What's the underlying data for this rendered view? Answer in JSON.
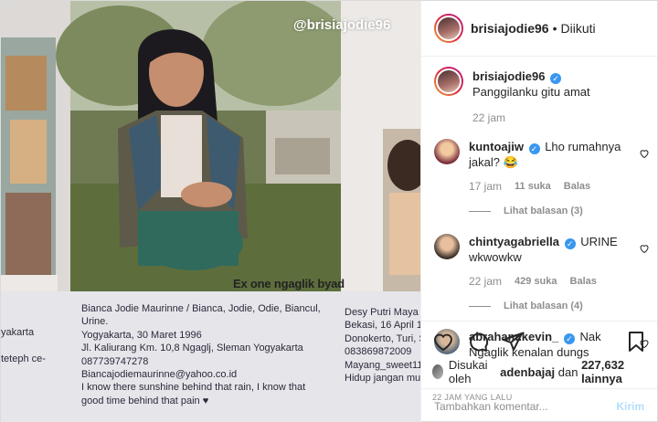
{
  "photo": {
    "watermark": "@brisiajodie96",
    "overlay_caption": "Ex one ngaglik byad",
    "bio_lines": [
      "Bianca Jodie Maurinne / Bianca, Jodie, Odie, Biancul,",
      "Urine.",
      "Yogyakarta, 30 Maret 1996",
      "Jl. Kaliurang Km. 10,8 Ngaglj, Sleman Yogyakarta",
      "087739747278",
      "Biancajodiemaurinne@yahoo.co.id",
      "I know there sunshine behind that rain, I know that",
      "good time behind that pain ♥"
    ],
    "bio_right_lines": [
      "Desy Putri Maya",
      "Bekasi, 16 April 1",
      "Donokerto, Turi, S",
      "083869872009",
      "Mayang_sweet11",
      "Hidup jangan mu"
    ],
    "bio_left_lines": [
      "yakarta",
      "",
      "teteph ce-"
    ]
  },
  "header": {
    "username": "brisiajodie96",
    "separator": "•",
    "follow_status": "Diikuti"
  },
  "caption": {
    "username": "brisiajodie96",
    "text": "Panggilanku gitu amat",
    "time": "22 jam"
  },
  "comments": [
    {
      "username": "kuntoajiw",
      "text": "Lho rumahnya jakal? 😂",
      "time": "17 jam",
      "likes": "11 suka",
      "reply": "Balas",
      "view_replies": "Lihat balasan (3)"
    },
    {
      "username": "chintyagabriella",
      "text": "URINE wkwowkw",
      "time": "22 jam",
      "likes": "429 suka",
      "reply": "Balas",
      "view_replies": "Lihat balasan (4)"
    },
    {
      "username": "abraham.kevin_",
      "text": "Nak Ngaglik kenalan dungs"
    }
  ],
  "liked_by": {
    "prefix": "Disukai oleh",
    "user": "adenbajaj",
    "connector": "dan",
    "count": "227,632 lainnya"
  },
  "post_age": "22 JAM YANG LALU",
  "add_comment": {
    "placeholder": "Tambahkan komentar...",
    "post_label": "Kirim"
  },
  "colors": {
    "link_blue": "#3897f0",
    "disabled_post": "#b2dffc",
    "muted": "#8e8e8e"
  }
}
